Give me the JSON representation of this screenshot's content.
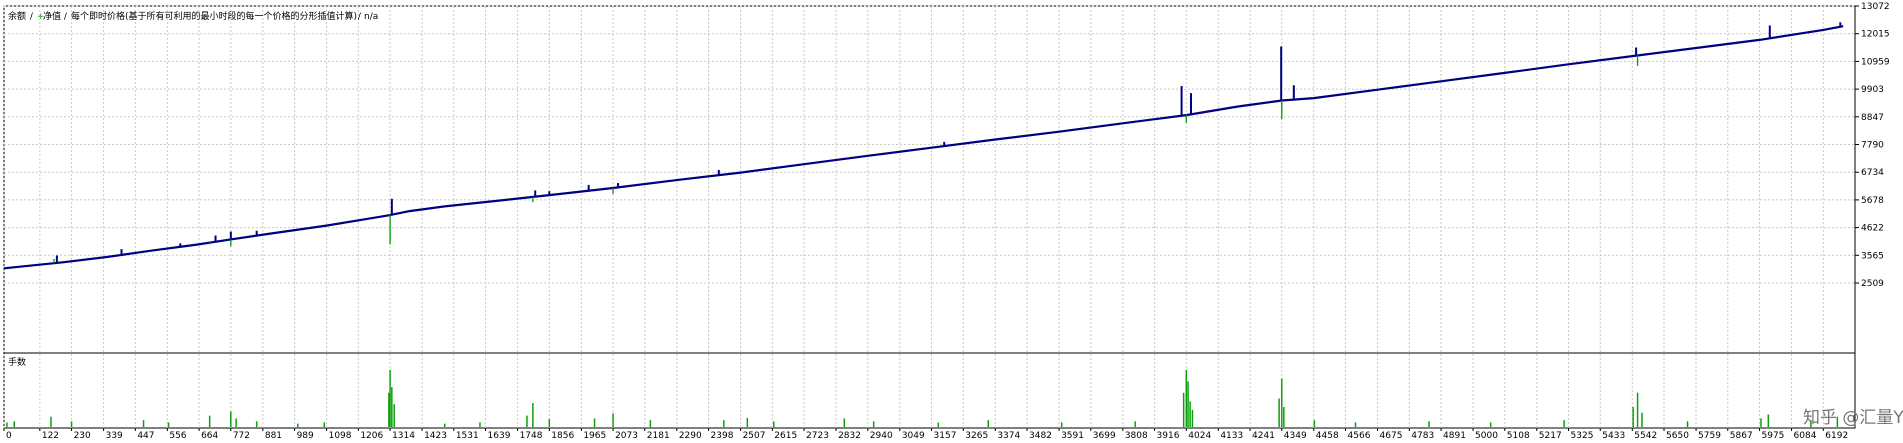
{
  "chart_data": [
    {
      "type": "line",
      "title": "余额 / 净值 / 每个即时价格(基于所有可利用的最小时段的每一个价格的分形插值计算) / n/a",
      "title_parts": {
        "balance": "余额",
        "equity": "净值",
        "description": "每个即时价格(基于所有可利用的最小时段的每一个价格的分形插值计算)",
        "period": "n/a",
        "separator": " / "
      },
      "xlabel": "",
      "ylabel": "",
      "grid": true,
      "xlim": [
        0,
        6300
      ],
      "ylim": [
        2509,
        13072
      ],
      "x_ticks": [
        0,
        122,
        230,
        339,
        447,
        556,
        664,
        772,
        881,
        989,
        1098,
        1206,
        1314,
        1423,
        1531,
        1639,
        1748,
        1856,
        1965,
        2073,
        2181,
        2290,
        2398,
        2507,
        2615,
        2723,
        2832,
        2940,
        3049,
        3157,
        3265,
        3374,
        3482,
        3591,
        3699,
        3808,
        3916,
        4024,
        4133,
        4241,
        4349,
        4458,
        4566,
        4675,
        4783,
        4891,
        5000,
        5108,
        5217,
        5325,
        5433,
        5542,
        5650,
        5759,
        5867,
        5975,
        6084,
        6192
      ],
      "y_ticks": [
        13072,
        12015,
        10959,
        9903,
        8847,
        7790,
        6734,
        5678,
        4622,
        3565,
        2509
      ],
      "series": [
        {
          "name": "余额",
          "color": "#000080",
          "points": [
            [
              0,
              3070
            ],
            [
              200,
              3300
            ],
            [
              350,
              3500
            ],
            [
              500,
              3740
            ],
            [
              650,
              3960
            ],
            [
              772,
              4170
            ],
            [
              900,
              4380
            ],
            [
              1100,
              4700
            ],
            [
              1314,
              5100
            ],
            [
              1380,
              5250
            ],
            [
              1500,
              5430
            ],
            [
              1700,
              5670
            ],
            [
              1856,
              5860
            ],
            [
              2073,
              6130
            ],
            [
              2300,
              6450
            ],
            [
              2507,
              6720
            ],
            [
              2723,
              7040
            ],
            [
              2940,
              7360
            ],
            [
              3157,
              7670
            ],
            [
              3374,
              7980
            ],
            [
              3591,
              8280
            ],
            [
              3808,
              8600
            ],
            [
              4024,
              8910
            ],
            [
              4200,
              9240
            ],
            [
              4349,
              9470
            ],
            [
              4458,
              9560
            ],
            [
              4675,
              9880
            ],
            [
              4891,
              10200
            ],
            [
              5108,
              10520
            ],
            [
              5325,
              10850
            ],
            [
              5542,
              11160
            ],
            [
              5759,
              11470
            ],
            [
              5975,
              11780
            ],
            [
              6192,
              12160
            ],
            [
              6260,
              12300
            ]
          ]
        },
        {
          "name": "净值",
          "color": "#0ba00b",
          "spikes": [
            [
              170,
              3430
            ],
            [
              700,
              3980
            ],
            [
              772,
              3910
            ],
            [
              1314,
              3980
            ],
            [
              1800,
              5590
            ],
            [
              2073,
              5910
            ],
            [
              4024,
              8620
            ],
            [
              4349,
              8760
            ],
            [
              5560,
              10790
            ]
          ]
        },
        {
          "name": "净值-excursions",
          "color": "#000080",
          "spikes": [
            [
              180,
              3560
            ],
            [
              400,
              3800
            ],
            [
              600,
              4020
            ],
            [
              720,
              4320
            ],
            [
              772,
              4470
            ],
            [
              860,
              4500
            ],
            [
              1320,
              5720
            ],
            [
              1808,
              6040
            ],
            [
              1856,
              6010
            ],
            [
              1990,
              6250
            ],
            [
              2090,
              6320
            ],
            [
              2433,
              6820
            ],
            [
              2811,
              7200
            ],
            [
              3200,
              7890
            ],
            [
              3660,
              8420
            ],
            [
              4008,
              10020
            ],
            [
              4040,
              9750
            ],
            [
              4347,
              11530
            ],
            [
              4390,
              10050
            ],
            [
              5555,
              11490
            ],
            [
              6010,
              12330
            ],
            [
              6250,
              12450
            ]
          ]
        }
      ]
    },
    {
      "type": "bar",
      "title": "手数",
      "xlabel": "",
      "ylabel": "",
      "xlim": [
        0,
        6300
      ],
      "ylim": [
        0,
        1
      ],
      "series": [
        {
          "name": "手数",
          "color": "#0ba00b",
          "bars": [
            [
              10,
              0.08
            ],
            [
              35,
              0.1
            ],
            [
              160,
              0.18
            ],
            [
              230,
              0.1
            ],
            [
              475,
              0.12
            ],
            [
              560,
              0.08
            ],
            [
              700,
              0.2
            ],
            [
              772,
              0.27
            ],
            [
              790,
              0.15
            ],
            [
              860,
              0.1
            ],
            [
              1000,
              0.06
            ],
            [
              1090,
              0.08
            ],
            [
              1310,
              0.6
            ],
            [
              1314,
              1.0
            ],
            [
              1320,
              0.7
            ],
            [
              1328,
              0.4
            ],
            [
              1500,
              0.06
            ],
            [
              1620,
              0.08
            ],
            [
              1780,
              0.2
            ],
            [
              1800,
              0.42
            ],
            [
              1856,
              0.14
            ],
            [
              2010,
              0.15
            ],
            [
              2073,
              0.24
            ],
            [
              2200,
              0.12
            ],
            [
              2450,
              0.12
            ],
            [
              2530,
              0.16
            ],
            [
              2620,
              0.1
            ],
            [
              2860,
              0.15
            ],
            [
              2960,
              0.1
            ],
            [
              3180,
              0.08
            ],
            [
              3350,
              0.12
            ],
            [
              3600,
              0.08
            ],
            [
              3850,
              0.1
            ],
            [
              4015,
              0.6
            ],
            [
              4024,
              1.0
            ],
            [
              4030,
              0.8
            ],
            [
              4037,
              0.45
            ],
            [
              4045,
              0.3
            ],
            [
              4340,
              0.5
            ],
            [
              4349,
              0.85
            ],
            [
              4356,
              0.35
            ],
            [
              4460,
              0.12
            ],
            [
              4600,
              0.08
            ],
            [
              4850,
              0.1
            ],
            [
              5060,
              0.08
            ],
            [
              5310,
              0.12
            ],
            [
              5545,
              0.35
            ],
            [
              5560,
              0.6
            ],
            [
              5575,
              0.25
            ],
            [
              5730,
              0.1
            ],
            [
              5980,
              0.15
            ],
            [
              6005,
              0.22
            ],
            [
              6150,
              0.12
            ],
            [
              6240,
              0.18
            ]
          ]
        }
      ]
    }
  ],
  "watermark": "知乎 @汇量YK"
}
